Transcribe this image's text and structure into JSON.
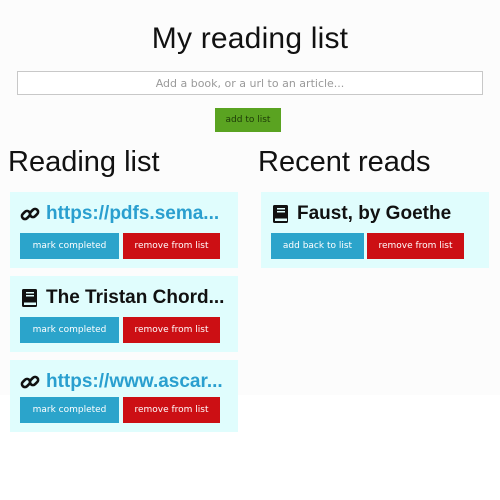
{
  "header": {
    "title": "My reading list",
    "input_placeholder": "Add a book, or a url to an article...",
    "add_button": "add to list"
  },
  "reading_list": {
    "heading": "Reading list",
    "items": [
      {
        "type": "link",
        "icon": "link-icon",
        "title": "https://pdfs.sema...",
        "primary_button": "mark completed",
        "secondary_button": "remove from list"
      },
      {
        "type": "book",
        "icon": "book-icon",
        "title": "The Tristan Chord...",
        "primary_button": "mark completed",
        "secondary_button": "remove from list"
      },
      {
        "type": "link",
        "icon": "link-icon",
        "title": "https://www.ascar...",
        "primary_button": "mark completed",
        "secondary_button": "remove from list"
      }
    ]
  },
  "recent_reads": {
    "heading": "Recent reads",
    "items": [
      {
        "type": "book",
        "icon": "book-icon",
        "title": "Faust, by Goethe",
        "primary_button": "add back to list",
        "secondary_button": "remove from list"
      }
    ]
  },
  "colors": {
    "card_background": "#e0fdfd",
    "link_text": "#2a9fcf",
    "button_blue": "#2ba4cb",
    "button_red": "#cc0f14",
    "button_green": "#5aa321"
  }
}
